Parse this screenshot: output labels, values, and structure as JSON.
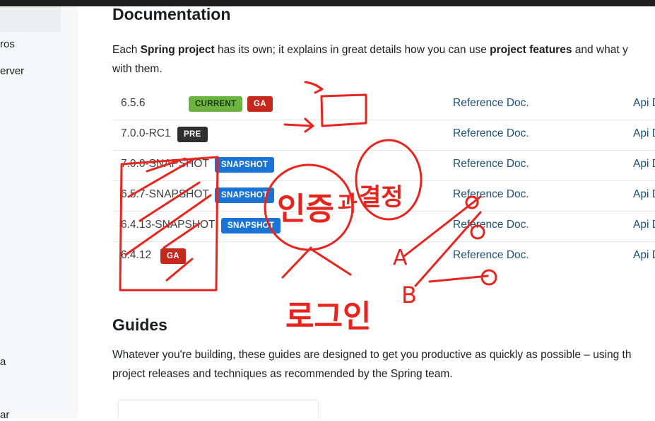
{
  "sidebar": {
    "items": [
      "ros",
      "erver",
      "a",
      "ar"
    ]
  },
  "documentation": {
    "title": "Documentation",
    "intro_part1": "Each ",
    "intro_bold1": "Spring project",
    "intro_part2": " has its own; it explains in great details how you can use ",
    "intro_bold2": "project features",
    "intro_part3": " and what y",
    "intro_line2": "with them.",
    "rows": [
      {
        "version": "6.5.6",
        "badges": [
          "CURRENT",
          "GA"
        ],
        "ref": "Reference Doc.",
        "api": "Api D"
      },
      {
        "version": "7.0.0-RC1",
        "badges": [
          "PRE"
        ],
        "ref": "Reference Doc.",
        "api": "Api D"
      },
      {
        "version": "7.0.0-SNAPSHOT",
        "badges": [
          "SNAPSHOT"
        ],
        "ref": "Reference Doc.",
        "api": "Api D"
      },
      {
        "version": "6.5.7-SNAPSHOT",
        "badges": [
          "SNAPSHOT"
        ],
        "ref": "Reference Doc.",
        "api": "Api D"
      },
      {
        "version": "6.4.13-SNAPSHOT",
        "badges": [
          "SNAPSHOT"
        ],
        "ref": "Reference Doc.",
        "api": "Api D"
      },
      {
        "version": "6.4.12",
        "badges": [
          "GA"
        ],
        "ref": "Reference Doc.",
        "api": "Api D"
      }
    ]
  },
  "guides": {
    "title": "Guides",
    "line1": "Whatever you're building, these guides are designed to get you productive as quickly as possible – using th",
    "line2": "project releases and techniques as recommended by the Spring team."
  },
  "annotations": {
    "word_authorization": "인증",
    "word_connector": "과",
    "word_decision": "결정",
    "word_login": "로그인",
    "letter_a": "A",
    "letter_b": "B",
    "ink_color": "#e8241c"
  },
  "colors": {
    "badge_current": "#6db33f",
    "badge_ga": "#c7281c",
    "badge_pre": "#2f2f2f",
    "badge_snapshot": "#1a74d6",
    "link": "#1e4f7a"
  }
}
